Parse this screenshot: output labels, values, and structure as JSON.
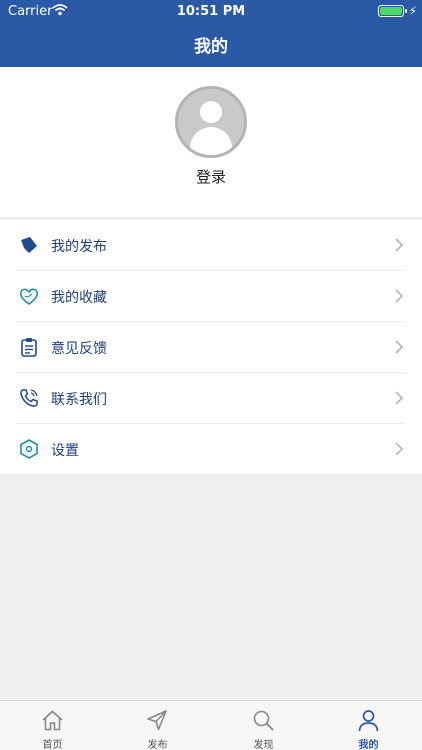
{
  "status_bar": {
    "carrier": "Carrier",
    "time": "10:51 PM"
  },
  "header": {
    "title": "我的"
  },
  "profile": {
    "login_label": "登录"
  },
  "menu": {
    "items": [
      {
        "label": "我的发布",
        "icon": "tag-icon"
      },
      {
        "label": "我的收藏",
        "icon": "heart-icon"
      },
      {
        "label": "意见反馈",
        "icon": "clipboard-icon"
      },
      {
        "label": "联系我们",
        "icon": "phone-icon"
      },
      {
        "label": "设置",
        "icon": "hexagon-settings-icon"
      }
    ]
  },
  "tabbar": {
    "tabs": [
      {
        "label": "首页",
        "icon": "home-icon",
        "active": false
      },
      {
        "label": "发布",
        "icon": "send-icon",
        "active": false
      },
      {
        "label": "发现",
        "icon": "search-icon",
        "active": false
      },
      {
        "label": "我的",
        "icon": "user-icon",
        "active": true
      }
    ]
  },
  "colors": {
    "primary": "#2a5aa6",
    "menu_text": "#1f3f7a",
    "background": "#efefef"
  }
}
